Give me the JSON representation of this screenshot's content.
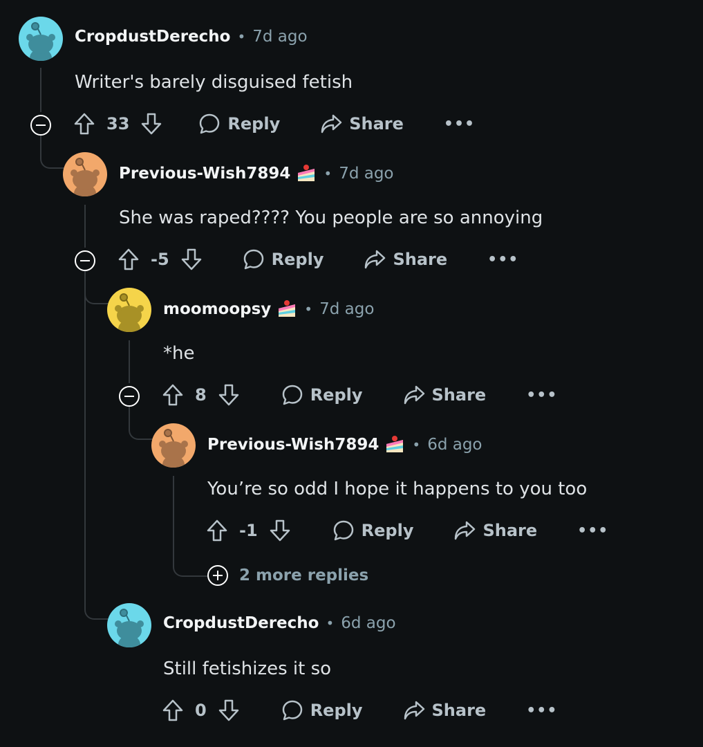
{
  "colors": {
    "background": "#0e1113",
    "avatar_teal": "#6bd8ea",
    "avatar_orange": "#f2a86b",
    "avatar_yellow": "#f5d44a"
  },
  "comments": [
    {
      "username": "CropdustDerecho",
      "time": "7d ago",
      "text": "Writer's barely disguised fetish",
      "score": "33",
      "avatar_color": "teal",
      "flair": null
    },
    {
      "username": "Previous-Wish7894",
      "time": "7d ago",
      "text": "She was raped???? You people are so annoying",
      "score": "-5",
      "avatar_color": "orange",
      "flair": "cake-icon"
    },
    {
      "username": "moomoopsy",
      "time": "7d ago",
      "text": "*he",
      "score": "8",
      "avatar_color": "yellow",
      "flair": "cake-icon"
    },
    {
      "username": "Previous-Wish7894",
      "time": "6d ago",
      "text": "You’re so odd I hope it happens to you too",
      "score": "-1",
      "avatar_color": "orange",
      "flair": "cake-icon"
    },
    {
      "username": "CropdustDerecho",
      "time": "6d ago",
      "text": "Still fetishizes it so",
      "score": "0",
      "avatar_color": "teal",
      "flair": null
    }
  ],
  "labels": {
    "reply": "Reply",
    "share": "Share",
    "more": "•••",
    "dot": "•",
    "more_replies": "2 more replies"
  }
}
